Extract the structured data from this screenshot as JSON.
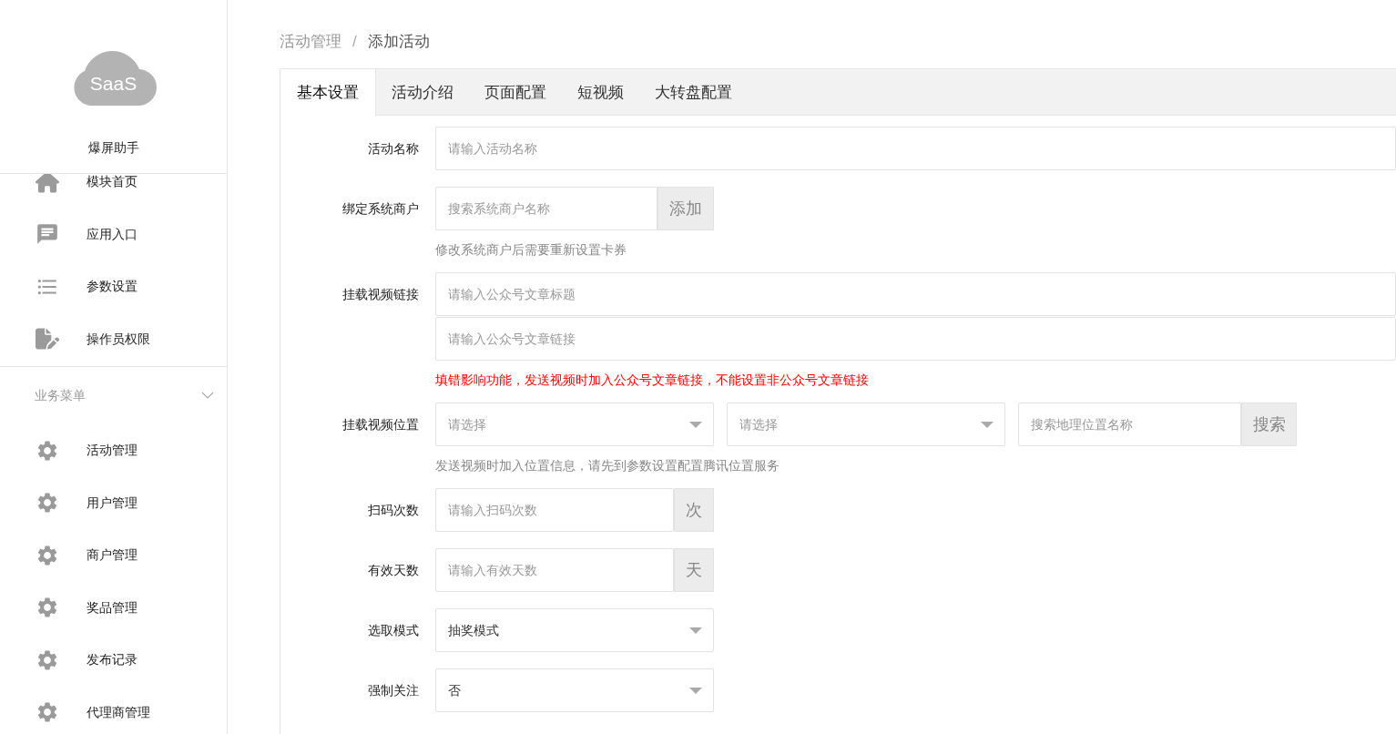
{
  "sidebar": {
    "logo_text": "SaaS",
    "app_name": "爆屏助手",
    "top_items": [
      {
        "label": "模块首页",
        "kind": "home"
      },
      {
        "label": "应用入口",
        "kind": "chat"
      },
      {
        "label": "参数设置",
        "kind": "list"
      },
      {
        "label": "操作员权限",
        "kind": "doc"
      }
    ],
    "section": {
      "title": "业务菜单",
      "expanded": true,
      "items": [
        {
          "label": "活动管理",
          "kind": "gear"
        },
        {
          "label": "用户管理",
          "kind": "gear"
        },
        {
          "label": "商户管理",
          "kind": "gear"
        },
        {
          "label": "奖品管理",
          "kind": "gear"
        },
        {
          "label": "发布记录",
          "kind": "gear"
        },
        {
          "label": "代理商管理",
          "kind": "gear"
        }
      ]
    }
  },
  "breadcrumb": [
    "活动管理",
    "添加活动"
  ],
  "breadcrumb_separator": "/",
  "tabs": [
    {
      "label": "基本设置",
      "selected": true
    },
    {
      "label": "活动介绍",
      "selected": false
    },
    {
      "label": "页面配置",
      "selected": false
    },
    {
      "label": "短视频",
      "selected": false
    },
    {
      "label": "大转盘配置",
      "selected": false
    }
  ],
  "form": [
    {
      "kind": "text",
      "label": "活动名称",
      "placeholder": "请输入活动名称"
    },
    {
      "kind": "addon_button",
      "label": "绑定系统商户",
      "placeholder": "搜索系统商户名称",
      "button": "添加",
      "hint": {
        "text": "修改系统商户后需要重新设置卡券",
        "warning": false
      }
    },
    {
      "kind": "stacked",
      "label": "挂载视频链接",
      "fields": [
        {
          "placeholder": "请输入公众号文章标题"
        },
        {
          "placeholder": "请输入公众号文章链接"
        }
      ],
      "hint": {
        "text": "填错影响功能，发送视频时加入公众号文章链接，不能设置非公众号文章链接",
        "warning": true
      }
    },
    {
      "kind": "location",
      "label": "挂载视频位置",
      "selects": [
        {
          "placeholder": "请选择"
        },
        {
          "placeholder": "请选择"
        }
      ],
      "search": {
        "placeholder": "搜索地理位置名称",
        "button": "搜索"
      },
      "hint": {
        "text": "发送视频时加入位置信息，请先到参数设置配置腾讯位置服务",
        "warning": false
      }
    },
    {
      "kind": "addon_unit",
      "label": "扫码次数",
      "placeholder": "请输入扫码次数",
      "unit": "次"
    },
    {
      "kind": "addon_unit",
      "label": "有效天数",
      "placeholder": "请输入有效天数",
      "unit": "天"
    },
    {
      "kind": "select",
      "label": "选取模式",
      "value": "抽奖模式"
    },
    {
      "kind": "select",
      "label": "强制关注",
      "value": "否"
    }
  ]
}
